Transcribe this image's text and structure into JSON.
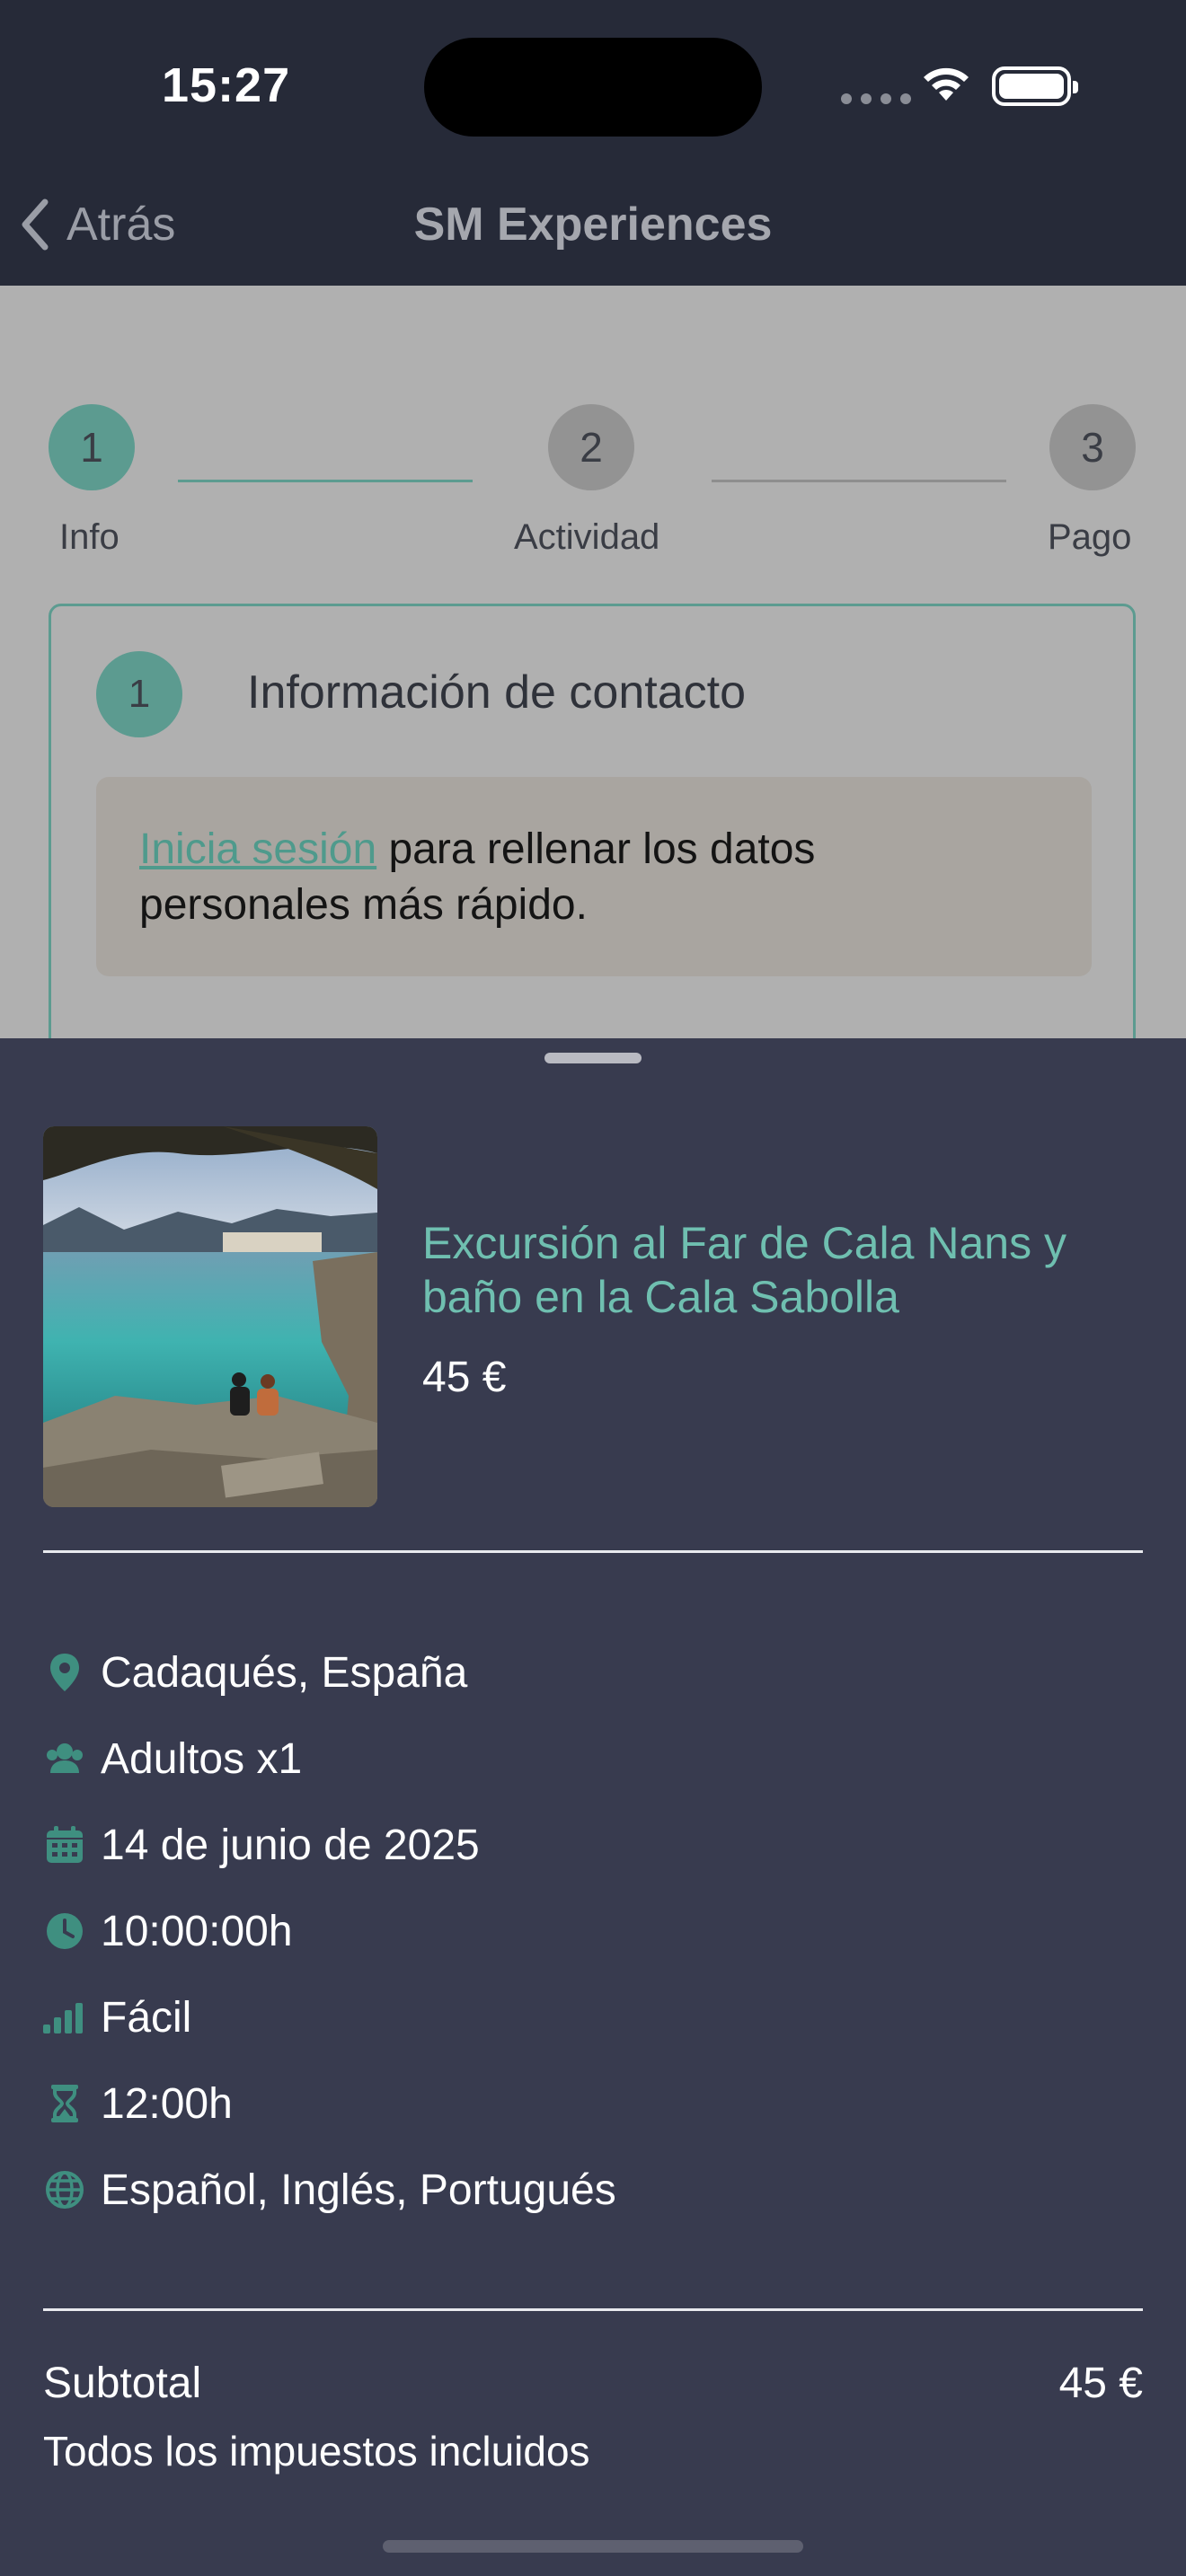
{
  "status_bar": {
    "time": "15:27"
  },
  "nav": {
    "back_label": "Atrás",
    "title": "SM Experiences"
  },
  "stepper": {
    "steps": [
      {
        "number": "1",
        "label": "Info"
      },
      {
        "number": "2",
        "label": "Actividad"
      },
      {
        "number": "3",
        "label": "Pago"
      }
    ]
  },
  "contact_section": {
    "number": "1",
    "title": "Información de contacto",
    "login_link": "Inicia sesión",
    "login_text": " para rellenar los datos personales más rápido."
  },
  "summary": {
    "product": {
      "title": "Excursión al Far de Cala Nans y baño en la Cala Sabolla",
      "price": "45 €"
    },
    "details": [
      {
        "icon": "location-pin-icon",
        "text": "Cadaqués, España"
      },
      {
        "icon": "people-icon",
        "text": "Adultos x1"
      },
      {
        "icon": "calendar-icon",
        "text": "14 de junio de 2025"
      },
      {
        "icon": "clock-icon",
        "text": "10:00:00h"
      },
      {
        "icon": "difficulty-bars-icon",
        "text": "Fácil"
      },
      {
        "icon": "hourglass-icon",
        "text": "12:00h"
      },
      {
        "icon": "globe-icon",
        "text": "Español, Inglés, Portugués"
      }
    ],
    "subtotal_label": "Subtotal",
    "subtotal_value": "45 €",
    "tax_note": "Todos los impuestos incluidos"
  },
  "colors": {
    "accent": "#3f8f80",
    "title_teal": "#6fbfb0",
    "sheet_bg": "#383b4f",
    "topbar_bg": "#262a38"
  }
}
